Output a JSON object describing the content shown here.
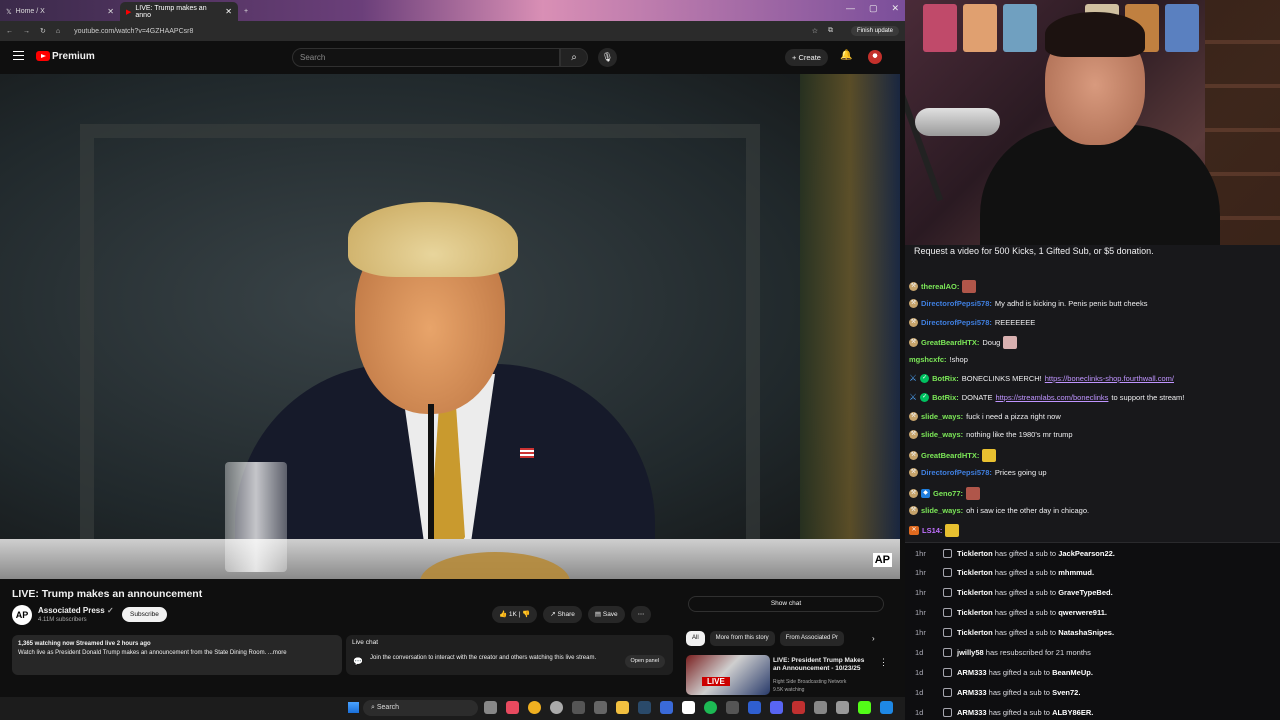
{
  "browser": {
    "tabs": [
      {
        "label": "Home / X",
        "active": false
      },
      {
        "label": "LIVE: Trump makes an anno",
        "active": true
      }
    ],
    "url": "youtube.com/watch?v=4GZHAAPCsr8",
    "update_label": "Finish update",
    "window_controls": [
      "—",
      "▢",
      "✕"
    ]
  },
  "youtube": {
    "brand": "Premium",
    "search_placeholder": "Search",
    "create_label": "Create",
    "video": {
      "watermark": "AP",
      "title": "LIVE: Trump makes an announcement",
      "channel": "Associated Press",
      "subscribers": "4.11M subscribers",
      "subscribe_label": "Subscribe",
      "likes": "1K",
      "share_label": "Share",
      "save_label": "Save",
      "meta": "1,365 watching now  Streamed live 2 hours ago",
      "description": "Watch live as President Donald Trump makes an announcement from the State Dining Room. ...more"
    },
    "live_chat": {
      "title": "Live chat",
      "text": "Join the conversation to interact with the creator and others watching this live stream.",
      "open_panel": "Open panel",
      "show_chat": "Show chat"
    },
    "chips": [
      "All",
      "More from this story",
      "From Associated Pr"
    ],
    "recommendation": {
      "badge": "LIVE",
      "title": "LIVE: President Trump Makes an Announcement - 10/23/25",
      "channel": "Right Side Broadcasting Network",
      "views": "9.5K watching"
    }
  },
  "taskbar": {
    "search_label": "Search"
  },
  "stream_chat": {
    "banner": "Request a video for 500 Kicks, 1 Gifted Sub, or $5 donation.",
    "messages": [
      {
        "user": "therealAO:",
        "text": "",
        "color": "u-green",
        "badge": "pick",
        "emote": "#b0564a"
      },
      {
        "user": "DirectorofPepsi578:",
        "text": "My adhd is kicking in. Penis penis butt cheeks",
        "color": "u-blue",
        "badge": "pick"
      },
      {
        "user": "DirectorofPepsi578:",
        "text": "REEEEEEE",
        "color": "u-blue",
        "badge": "pick"
      },
      {
        "user": "GreatBeardHTX:",
        "text": "Doug",
        "color": "u-green",
        "badge": "pick",
        "emote": "#d8b0b0"
      },
      {
        "user": "mgshcxfc:",
        "text": "!shop",
        "color": "u-green",
        "badge": ""
      },
      {
        "user": "BotRix:",
        "text": "BONECLINKS MERCH!",
        "link": "https://boneclinks-shop.fourthwall.com/",
        "color": "u-green",
        "badge": "bot"
      },
      {
        "user": "BotRix:",
        "text": "DONATE",
        "link": "https://streamlabs.com/boneclinks",
        "after": "to support the stream!",
        "color": "u-green",
        "badge": "bot"
      },
      {
        "user": "slide_ways:",
        "text": "fuck i need a pizza right now",
        "color": "u-green",
        "badge": "pick"
      },
      {
        "user": "slide_ways:",
        "text": "nothing like the 1980's mr trump",
        "color": "u-green",
        "badge": "pick"
      },
      {
        "user": "GreatBeardHTX:",
        "text": "",
        "color": "u-green",
        "badge": "pick",
        "emote": "#e8c030"
      },
      {
        "user": "DirectorofPepsi578:",
        "text": "Prices going up",
        "color": "u-blue",
        "badge": "pick"
      },
      {
        "user": "Geno77:",
        "text": "",
        "color": "u-green",
        "badge": "box",
        "emote": "#b0564a"
      },
      {
        "user": "slide_ways:",
        "text": "oh i saw ice the other day in chicago.",
        "color": "u-green",
        "badge": "pick"
      },
      {
        "user": "LS14:",
        "text": "",
        "color": "u-ls",
        "badge": "ls",
        "emote": "#e8c030"
      }
    ]
  },
  "sub_events": [
    {
      "time": "1hr",
      "user": "Ticklerton",
      "action": "has gifted a sub to",
      "target": "JackPearson22."
    },
    {
      "time": "1hr",
      "user": "Ticklerton",
      "action": "has gifted a sub to",
      "target": "mhmmud."
    },
    {
      "time": "1hr",
      "user": "Ticklerton",
      "action": "has gifted a sub to",
      "target": "GraveTypeBed."
    },
    {
      "time": "1hr",
      "user": "Ticklerton",
      "action": "has gifted a sub to",
      "target": "qwerwere911."
    },
    {
      "time": "1hr",
      "user": "Ticklerton",
      "action": "has gifted a sub to",
      "target": "NatashaSnipes."
    },
    {
      "time": "1d",
      "user": "jwilly58",
      "action": "has resubscribed for 21 months",
      "target": ""
    },
    {
      "time": "1d",
      "user": "ARM333",
      "action": "has gifted a sub to",
      "target": "BeanMeUp."
    },
    {
      "time": "1d",
      "user": "ARM333",
      "action": "has gifted a sub to",
      "target": "Sven72."
    },
    {
      "time": "1d",
      "user": "ARM333",
      "action": "has gifted a sub to",
      "target": "ALBY86ER."
    }
  ]
}
